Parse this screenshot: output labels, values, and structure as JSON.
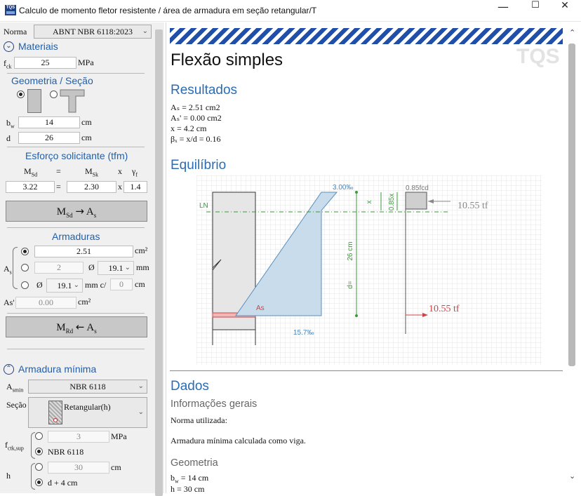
{
  "window": {
    "title": "Calculo de momento fletor resistente / área de armadura em seção retangular/T",
    "icon_text": "TQS",
    "controls": {
      "minimize": "—",
      "maximize": "☐",
      "close": "✕"
    }
  },
  "left": {
    "norma": {
      "label": "Norma",
      "value": "ABNT NBR 6118:2023"
    },
    "materiais": {
      "title": "Materiais",
      "fck_label": "f",
      "fck_sub": "ck",
      "fck_value": "25",
      "fck_unit": "MPa"
    },
    "geometria": {
      "title": "Geometria / Seção",
      "bw_label": "b",
      "bw_sub": "w",
      "bw_value": "14",
      "bw_unit": "cm",
      "d_label": "d",
      "d_value": "26",
      "d_unit": "cm"
    },
    "esforco": {
      "title": "Esforço solicitante (tfm)",
      "msd": "M",
      "msd_sub": "Sd",
      "eq": "=",
      "msk": "M",
      "msk_sub": "Sk",
      "x": "x",
      "gf": "γ",
      "gf_sub": "f",
      "msd_value": "3.22",
      "msk_value": "2.30",
      "gf_value": "1.4"
    },
    "btn_msd": {
      "m": "M",
      "sub": "Sd",
      "arrow": "→",
      "a": "A",
      "asub": "s"
    },
    "armaduras": {
      "title": "Armaduras",
      "as_label": "A",
      "as_sub": "s",
      "as_value": "2.51",
      "as_unit": "cm²",
      "n_value": "2",
      "phi": "Ø",
      "phi1": "19.1",
      "mm": "mm",
      "phi2": "19.1",
      "mmc": "mm c/",
      "spacing": "0",
      "cm": "cm",
      "asl_label": "As'",
      "asl_value": "0.00",
      "asl_unit": "cm²"
    },
    "btn_mrd": {
      "m": "M",
      "sub": "Rd",
      "arrow": "←",
      "a": "A",
      "asub": "s"
    },
    "minima": {
      "title": "Armadura mínima",
      "asmin_label": "A",
      "asmin_sub": "smin",
      "asmin_value": "NBR 6118",
      "secao_label": "Seção",
      "secao_value": "Retangular(h)",
      "fctk_label": "f",
      "fctk_sub": "ctk,sup",
      "fctk_value": "3",
      "fctk_unit": "MPa",
      "fctk_opt": "NBR 6118",
      "h_label": "h",
      "h_value": "30",
      "h_unit": "cm",
      "h_opt": "d + 4 cm"
    }
  },
  "report": {
    "watermark": "TQS",
    "title": "Flexão simples",
    "resultados": {
      "title": "Resultados",
      "lines": [
        "Aₛ = 2.51 cm2",
        "Aₛ' = 0.00 cm2",
        "x = 4.2 cm",
        "βₓ = x/d = 0.16"
      ]
    },
    "equilibrio": {
      "title": "Equilíbrio",
      "ln": "LN",
      "top_strain": "3.00‰",
      "x": "x",
      "x85": "0.85x",
      "fcd": "0.85fcd",
      "force_top": "10.55 tf",
      "d_label": "26 cm",
      "d_eq": "d=",
      "as": "As",
      "force_bottom": "10.55 tf",
      "bottom_strain": "15.7‰"
    },
    "dados": {
      "title": "Dados",
      "info_title": "Informações gerais",
      "norma": "Norma utilizada:",
      "minima": "Armadura mínima calculada como viga.",
      "geo_title": "Geometria",
      "bw": "b",
      "bw_sub": "w",
      "bw_rest": " = 14 cm",
      "h_line": "h = 30 cm"
    }
  }
}
